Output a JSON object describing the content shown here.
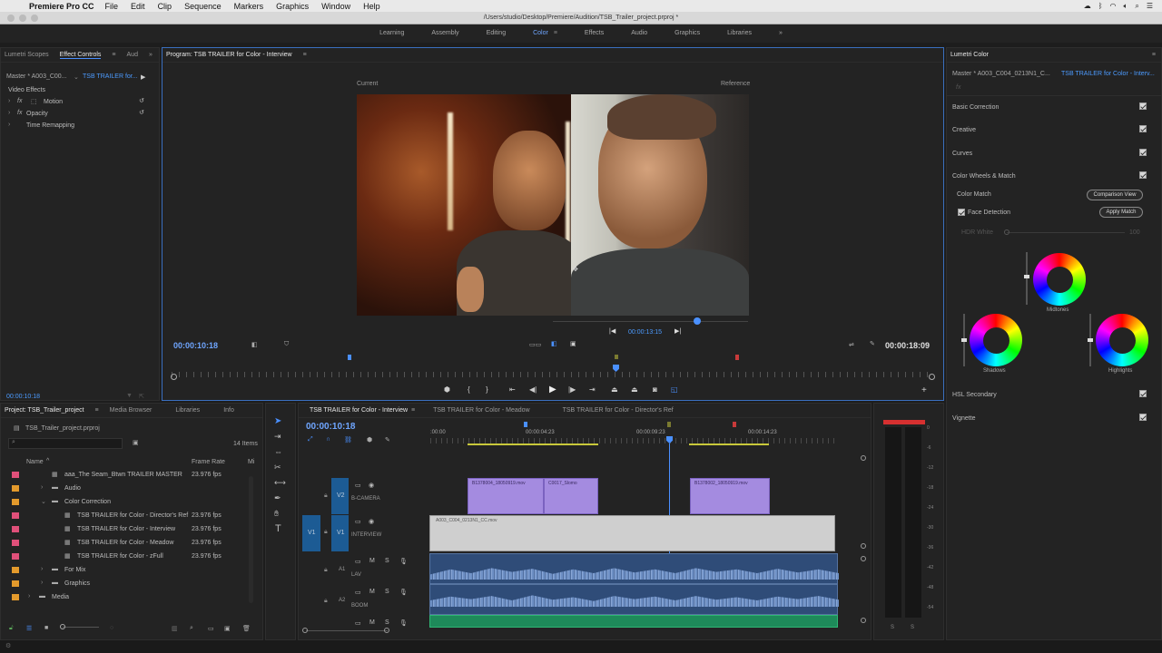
{
  "menubar": {
    "app": "Premiere Pro CC",
    "items": [
      "File",
      "Edit",
      "Clip",
      "Sequence",
      "Markers",
      "Graphics",
      "Window",
      "Help"
    ]
  },
  "titlebar": {
    "path": "/Users/studio/Desktop/Premiere/Audition/TSB_Trailer_project.prproj *"
  },
  "workspaces": [
    {
      "label": "Learning"
    },
    {
      "label": "Assembly"
    },
    {
      "label": "Editing"
    },
    {
      "label": "Color",
      "active": true
    },
    {
      "label": "Effects"
    },
    {
      "label": "Audio"
    },
    {
      "label": "Graphics"
    },
    {
      "label": "Libraries"
    }
  ],
  "source_panel": {
    "tabs": [
      "Lumetri Scopes",
      "Effect Controls",
      "Aud"
    ],
    "master": "Master * A003_C00...",
    "clip": "TSB TRAILER for...",
    "section": "Video Effects",
    "effects": [
      "Motion",
      "Opacity",
      "Time Remapping"
    ],
    "timecode": "00:00:10:18"
  },
  "program": {
    "title": "Program: TSB TRAILER for Color - Interview",
    "label_current": "Current",
    "label_reference": "Reference",
    "timecode_left": "00:00:10:18",
    "timecode_mid": "00:00:13:15",
    "timecode_right": "00:00:18:09"
  },
  "lumetri": {
    "title": "Lumetri Color",
    "master": "Master * A003_C004_0213N1_C...",
    "clip": "TSB TRAILER for Color - Interv...",
    "sections": [
      "Basic Correction",
      "Creative",
      "Curves",
      "Color Wheels & Match"
    ],
    "color_match": "Color Match",
    "comparison_view": "Comparison View",
    "face_detection": "Face Detection",
    "apply_match": "Apply Match",
    "hdr_white": "HDR White",
    "hdr_value": "100",
    "midtones": "Midtones",
    "shadows": "Shadows",
    "highlights": "Highlights",
    "hsl_secondary": "HSL Secondary",
    "vignette": "Vignette"
  },
  "project": {
    "tabs": [
      "Project: TSB_Trailer_project",
      "Media Browser",
      "Libraries",
      "Info"
    ],
    "file": "TSB_Trailer_project.prproj",
    "items_count": "14 Items",
    "col_name": "Name",
    "col_rate": "Frame Rate",
    "col_m": "Mi",
    "rows": [
      {
        "name": "aaa_The Seam_Btwn TRAILER MASTER",
        "rate": "23.976 fps",
        "color": "#e0507a",
        "indent": 1,
        "kind": "seq"
      },
      {
        "name": "Audio",
        "rate": "",
        "color": "#e39a2c",
        "indent": 1,
        "kind": "folder"
      },
      {
        "name": "Color Correction",
        "rate": "",
        "color": "#e39a2c",
        "indent": 1,
        "kind": "folder-open"
      },
      {
        "name": "TSB TRAILER for Color - Director's Ref",
        "rate": "23.976 fps",
        "color": "#e0507a",
        "indent": 2,
        "kind": "seq"
      },
      {
        "name": "TSB TRAILER for Color - Interview",
        "rate": "23.976 fps",
        "color": "#e0507a",
        "indent": 2,
        "kind": "seq"
      },
      {
        "name": "TSB TRAILER for Color - Meadow",
        "rate": "23.976 fps",
        "color": "#e0507a",
        "indent": 2,
        "kind": "seq"
      },
      {
        "name": "TSB TRAILER for Color - zFull",
        "rate": "23.976 fps",
        "color": "#e0507a",
        "indent": 2,
        "kind": "seq"
      },
      {
        "name": "For Mix",
        "rate": "",
        "color": "#e39a2c",
        "indent": 1,
        "kind": "folder"
      },
      {
        "name": "Graphics",
        "rate": "",
        "color": "#e39a2c",
        "indent": 1,
        "kind": "folder"
      },
      {
        "name": "Media",
        "rate": "",
        "color": "#e39a2c",
        "indent": 0,
        "kind": "folder"
      }
    ]
  },
  "timeline": {
    "tabs": [
      "TSB TRAILER for Color - Interview",
      "TSB TRAILER for Color - Meadow",
      "TSB TRAILER for Color - Director's Ref"
    ],
    "timecode": "00:00:10:18",
    "ruler": [
      ":00:00",
      "00:00:04:23",
      "00:00:09:23",
      "00:00:14:23"
    ],
    "tracks": {
      "v2_name": "B-CAMERA",
      "v1_name": "INTERVIEW",
      "a1_name": "LAV",
      "a2_name": "BOOM",
      "v2_label": "V2",
      "v1_label": "V1",
      "v1_src": "V1",
      "a1_label": "A1",
      "a2_label": "A2"
    },
    "clips": {
      "b1": "B1378004_18050919.mov",
      "b2": "C0017_Slomo",
      "b3": "B1378002_18050919.mov",
      "interview": "A003_C004_0213N1_CC.mov"
    }
  },
  "meter": {
    "labels": [
      "0",
      "-6",
      "-12",
      "-18",
      "-24",
      "-30",
      "-36",
      "-42",
      "-48",
      "-54"
    ],
    "bottom": [
      "S",
      "S"
    ]
  }
}
